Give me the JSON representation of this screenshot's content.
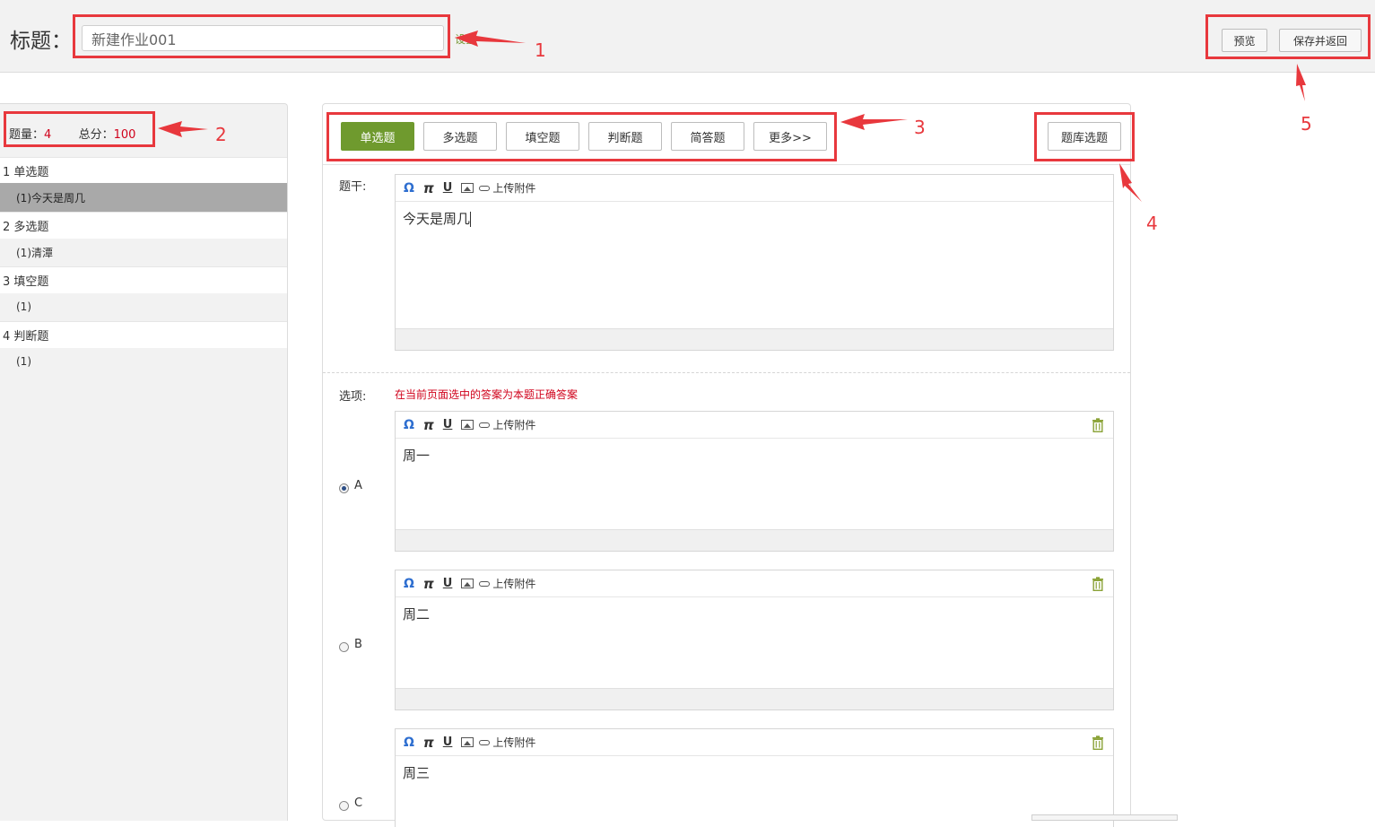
{
  "header": {
    "title_label": "标题：",
    "title_value": "新建作业001",
    "settings_link": "设置",
    "preview_button": "预览",
    "save_return_button": "保存并返回"
  },
  "sidebar": {
    "count_label": "题量：",
    "count_value": "4",
    "score_label": "总分：",
    "score_value": "100",
    "rows": [
      {
        "kind": "category",
        "label": "1 单选题"
      },
      {
        "kind": "item",
        "label": "(1)今天是周几",
        "active": true
      },
      {
        "kind": "category",
        "label": "2 多选题"
      },
      {
        "kind": "item",
        "label": "(1)清潭"
      },
      {
        "kind": "category",
        "label": "3 填空题"
      },
      {
        "kind": "item",
        "label": "(1)"
      },
      {
        "kind": "category",
        "label": "4 判断题"
      },
      {
        "kind": "item",
        "label": "(1)"
      }
    ]
  },
  "types": {
    "single": "单选题",
    "multiple": "多选题",
    "fill": "填空题",
    "judge": "判断题",
    "short": "简答题",
    "more": "更多>>",
    "bank": "题库选题"
  },
  "editor_toolbar": {
    "omega": "Ω",
    "pi": "π",
    "underline": "U",
    "upload": "上传附件"
  },
  "stem": {
    "label": "题干:",
    "content": "今天是周几"
  },
  "options": {
    "label": "选项:",
    "hint": "在当前页面选中的答案为本题正确答案",
    "items": [
      {
        "letter": "A",
        "content": "周一",
        "selected": true
      },
      {
        "letter": "B",
        "content": "周二",
        "selected": false
      },
      {
        "letter": "C",
        "content": "周三",
        "selected": false
      }
    ]
  },
  "annotations": [
    "1",
    "2",
    "3",
    "4",
    "5"
  ],
  "colors": {
    "accent_green": "#6f9a2e",
    "annotation_red": "#e8383d",
    "hint_red": "#d0021b"
  }
}
